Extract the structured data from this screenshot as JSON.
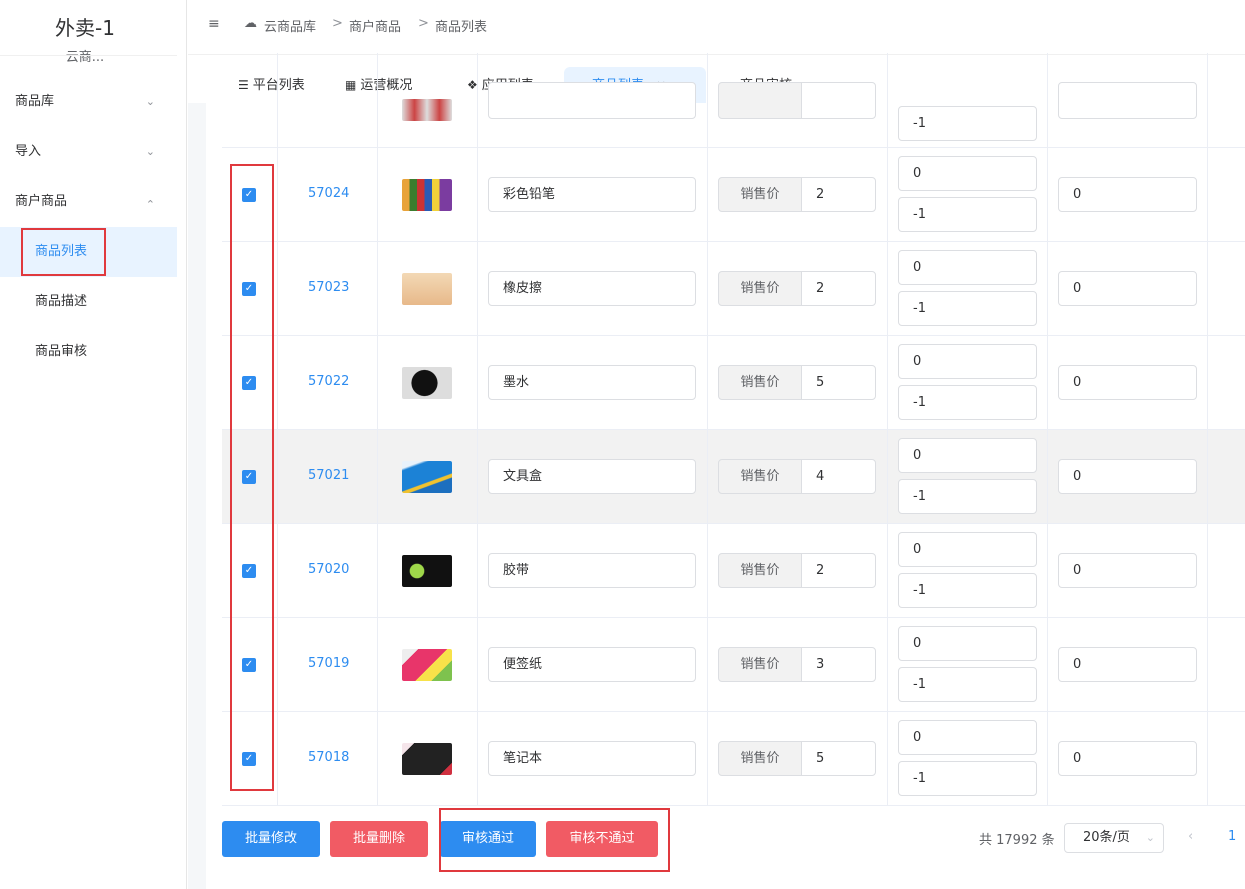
{
  "app": {
    "title": "外卖-1",
    "subtitle": "云商..."
  },
  "sidebar": {
    "items": [
      {
        "label": "商品库",
        "arrow": "chevron-down-icon"
      },
      {
        "label": "导入",
        "arrow": "chevron-down-icon"
      },
      {
        "label": "商户商品",
        "arrow": "chevron-up-icon"
      }
    ],
    "subitems": [
      {
        "label": "商品列表",
        "active": true
      },
      {
        "label": "商品描述",
        "active": false
      },
      {
        "label": "商品审核",
        "active": false
      }
    ]
  },
  "breadcrumb": {
    "items": [
      "云商品库",
      "商户商品",
      "商品列表"
    ],
    "separator": ">"
  },
  "tabs": [
    {
      "label": "平台列表",
      "icon": "list-icon"
    },
    {
      "label": "运营概况",
      "icon": "grid-icon"
    },
    {
      "label": "应用列表",
      "icon": "apps-icon"
    },
    {
      "label": "商品列表",
      "icon": "cloud-icon",
      "active": true,
      "close": "×"
    },
    {
      "label": "商品审核",
      "icon": "cloud-icon"
    }
  ],
  "table": {
    "partial_row": {
      "field1": "-1"
    },
    "price_label": "销售价",
    "rows": [
      {
        "id": "57024",
        "name": "彩色铅笔",
        "price": "2",
        "stock_a": "0",
        "stock_b": "-1",
        "extra": "0",
        "checked": true,
        "highlight": false
      },
      {
        "id": "57023",
        "name": "橡皮擦",
        "price": "2",
        "stock_a": "0",
        "stock_b": "-1",
        "extra": "0",
        "checked": true,
        "highlight": false
      },
      {
        "id": "57022",
        "name": "墨水",
        "price": "5",
        "stock_a": "0",
        "stock_b": "-1",
        "extra": "0",
        "checked": true,
        "highlight": false
      },
      {
        "id": "57021",
        "name": "文具盒",
        "price": "4",
        "stock_a": "0",
        "stock_b": "-1",
        "extra": "0",
        "checked": true,
        "highlight": true
      },
      {
        "id": "57020",
        "name": "胶带",
        "price": "2",
        "stock_a": "0",
        "stock_b": "-1",
        "extra": "0",
        "checked": true,
        "highlight": false
      },
      {
        "id": "57019",
        "name": "便签纸",
        "price": "3",
        "stock_a": "0",
        "stock_b": "-1",
        "extra": "0",
        "checked": true,
        "highlight": false
      },
      {
        "id": "57018",
        "name": "笔记本",
        "price": "5",
        "stock_a": "0",
        "stock_b": "-1",
        "extra": "0",
        "checked": true,
        "highlight": false
      }
    ]
  },
  "actions": {
    "batch_edit": "批量修改",
    "batch_delete": "批量删除",
    "approve": "审核通过",
    "reject": "审核不通过"
  },
  "pagination": {
    "total": "共 17992 条",
    "page_size": "20条/页",
    "current_page": "1"
  },
  "colors": {
    "primary": "#2d8cf0",
    "danger": "#f15b64",
    "annotation": "#e0393e"
  }
}
